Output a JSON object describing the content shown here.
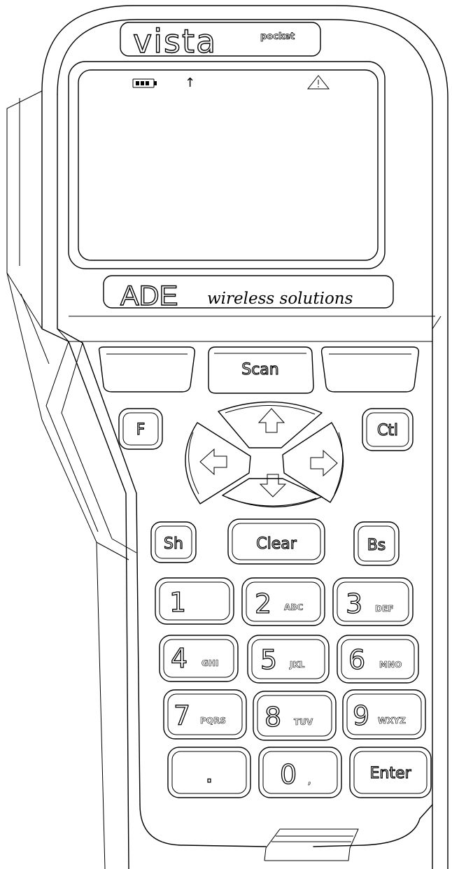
{
  "brand": {
    "name": "vista",
    "model": "pocket"
  },
  "maker": {
    "logo": "ADE",
    "tagline": "wireless solutions"
  },
  "screen": {
    "status_icons": [
      "battery-icon",
      "signal-arrow-icon",
      "warning-triangle-icon"
    ],
    "signal_glyph": "↑",
    "warning_glyph": "⚠"
  },
  "keys": {
    "soft_left": "",
    "scan": "Scan",
    "soft_right": "",
    "f": "F",
    "ctl": "Ctl",
    "nav": [
      "up-arrow-icon",
      "left-arrow-icon",
      "right-arrow-icon",
      "down-arrow-icon"
    ],
    "sh": "Sh",
    "clear": "Clear",
    "bs": "Bs",
    "keypad": [
      {
        "main": "1",
        "sub": ""
      },
      {
        "main": "2",
        "sub": "ABC"
      },
      {
        "main": "3",
        "sub": "DEF"
      },
      {
        "main": "4",
        "sub": "GHI"
      },
      {
        "main": "5",
        "sub": "JKL"
      },
      {
        "main": "6",
        "sub": "MNO"
      },
      {
        "main": "7",
        "sub": "PQRS"
      },
      {
        "main": "8",
        "sub": "TUV"
      },
      {
        "main": "9",
        "sub": "WXYZ"
      },
      {
        "main": ".",
        "sub": ""
      },
      {
        "main": "0",
        "sub": ","
      },
      {
        "main": "Enter",
        "sub": ""
      }
    ]
  }
}
